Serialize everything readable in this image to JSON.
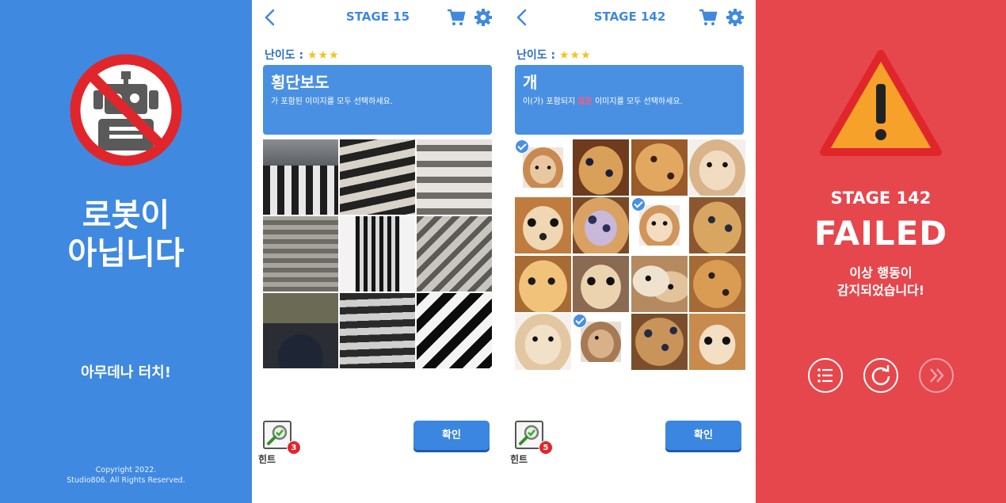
{
  "intro": {
    "title_line1": "로봇이",
    "title_line2": "아닙니다",
    "touch_prompt": "아무데나 터치!",
    "copyright_line1": "Copyright 2022.",
    "copyright_line2": "Studio806. All Rights Reserved."
  },
  "stage15": {
    "title": "STAGE 15",
    "difficulty_label": "난이도 :",
    "stars": "★★★",
    "keyword": "횡단보도",
    "instruction": "가 포함된 이미지를 모두 선택하세요.",
    "hint_count": "3",
    "hint_label": "힌트",
    "confirm_label": "확인"
  },
  "stage142": {
    "title": "STAGE 142",
    "difficulty_label": "난이도 :",
    "stars": "★★★",
    "keyword": "개",
    "instruction_pre": "이(가) 포함되지 ",
    "instruction_neg": "않은",
    "instruction_post": " 이미지를 모두 선택하세요.",
    "hint_count": "5",
    "hint_label": "힌트",
    "confirm_label": "확인"
  },
  "result": {
    "stage": "STAGE 142",
    "status": "FAILED",
    "msg_line1": "이상 행동이",
    "msg_line2": "감지되었습니다!"
  },
  "colors": {
    "blue_bg": "#3f89e0",
    "red_bg": "#e5474d",
    "prompt_blue": "#4a90e2",
    "star_yellow": "#f3c21b"
  }
}
